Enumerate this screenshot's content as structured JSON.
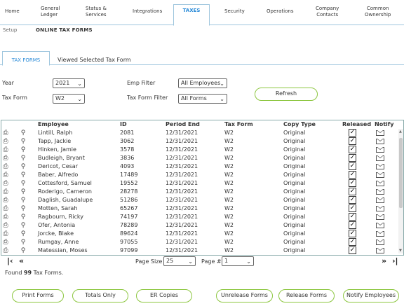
{
  "nav": {
    "tabs": [
      {
        "label": "Home"
      },
      {
        "label": "General\nLedger"
      },
      {
        "label": "Status &\nServices"
      },
      {
        "label": "Integrations"
      },
      {
        "label": "TAXES"
      },
      {
        "label": "Security"
      },
      {
        "label": "Operations"
      },
      {
        "label": "Company\nContacts"
      },
      {
        "label": "Common\nOwnership"
      }
    ],
    "sub_setup": "Setup",
    "sub_online": "ONLINE TAX FORMS"
  },
  "inner_tabs": {
    "active": "TAX FORMS",
    "other": "Viewed Selected Tax Form"
  },
  "filters": {
    "year_label": "Year",
    "year_value": "2021",
    "taxform_label": "Tax Form",
    "taxform_value": "W2",
    "emp_label": "Emp Filter",
    "emp_value": "All Employees",
    "taxform_filter_label": "Tax Form Filter",
    "taxform_filter_value": "All Forms",
    "refresh_label": "Refresh"
  },
  "grid": {
    "columns": [
      "Employee",
      "ID",
      "Period End",
      "Tax Form",
      "Copy Type",
      "Released",
      "Notify"
    ],
    "rows": [
      {
        "employee": "Lintill, Ralph",
        "id": "2081",
        "period_end": "12/31/2021",
        "tax_form": "W2",
        "copy_type": "Original",
        "released": true
      },
      {
        "employee": "Tapp, Jackie",
        "id": "3062",
        "period_end": "12/31/2021",
        "tax_form": "W2",
        "copy_type": "Original",
        "released": true
      },
      {
        "employee": "Hinken, Jamie",
        "id": "3578",
        "period_end": "12/31/2021",
        "tax_form": "W2",
        "copy_type": "Original",
        "released": true
      },
      {
        "employee": "Budleigh, Bryant",
        "id": "3836",
        "period_end": "12/31/2021",
        "tax_form": "W2",
        "copy_type": "Original",
        "released": true
      },
      {
        "employee": "Dericot, Cesar",
        "id": "4093",
        "period_end": "12/31/2021",
        "tax_form": "W2",
        "copy_type": "Original",
        "released": true
      },
      {
        "employee": "Baber, Alfredo",
        "id": "17489",
        "period_end": "12/31/2021",
        "tax_form": "W2",
        "copy_type": "Original",
        "released": true
      },
      {
        "employee": "Cottesford, Samuel",
        "id": "19552",
        "period_end": "12/31/2021",
        "tax_form": "W2",
        "copy_type": "Original",
        "released": true
      },
      {
        "employee": "Roderigo, Cameron",
        "id": "28278",
        "period_end": "12/31/2021",
        "tax_form": "W2",
        "copy_type": "Original",
        "released": true
      },
      {
        "employee": "Daglish, Guadalupe",
        "id": "51286",
        "period_end": "12/31/2021",
        "tax_form": "W2",
        "copy_type": "Original",
        "released": true
      },
      {
        "employee": "Motten, Sarah",
        "id": "65267",
        "period_end": "12/31/2021",
        "tax_form": "W2",
        "copy_type": "Original",
        "released": true
      },
      {
        "employee": "Ragbourn, Ricky",
        "id": "74197",
        "period_end": "12/31/2021",
        "tax_form": "W2",
        "copy_type": "Original",
        "released": true
      },
      {
        "employee": "Ofer, Antonia",
        "id": "78289",
        "period_end": "12/31/2021",
        "tax_form": "W2",
        "copy_type": "Original",
        "released": true
      },
      {
        "employee": "Jorcke, Blake",
        "id": "89624",
        "period_end": "12/31/2021",
        "tax_form": "W2",
        "copy_type": "Original",
        "released": true
      },
      {
        "employee": "Rumgay, Anne",
        "id": "97055",
        "period_end": "12/31/2021",
        "tax_form": "W2",
        "copy_type": "Original",
        "released": true
      },
      {
        "employee": "Matessian, Moses",
        "id": "97099",
        "period_end": "12/31/2021",
        "tax_form": "W2",
        "copy_type": "Original",
        "released": true
      }
    ]
  },
  "pager": {
    "first_glyph": "|‹",
    "prev_glyph": "«",
    "next_glyph": "»",
    "last_glyph": "›|",
    "page_size_label": "Page Size",
    "page_size_value": "25",
    "page_num_label": "Page #",
    "page_num_value": "1"
  },
  "found": {
    "prefix": "Found",
    "count": "99",
    "suffix": "Tax Forms."
  },
  "actions": {
    "print_forms": "Print Forms",
    "totals_only": "Totals Only",
    "er_copies": "ER Copies",
    "unrelease_forms": "Unrelease Forms",
    "release_forms": "Release Forms",
    "notify_employees": "Notify Employees"
  },
  "colors": {
    "accent": "#2a8bd8",
    "pill_border": "#8cc63f",
    "tab_border": "#9fc6de"
  }
}
